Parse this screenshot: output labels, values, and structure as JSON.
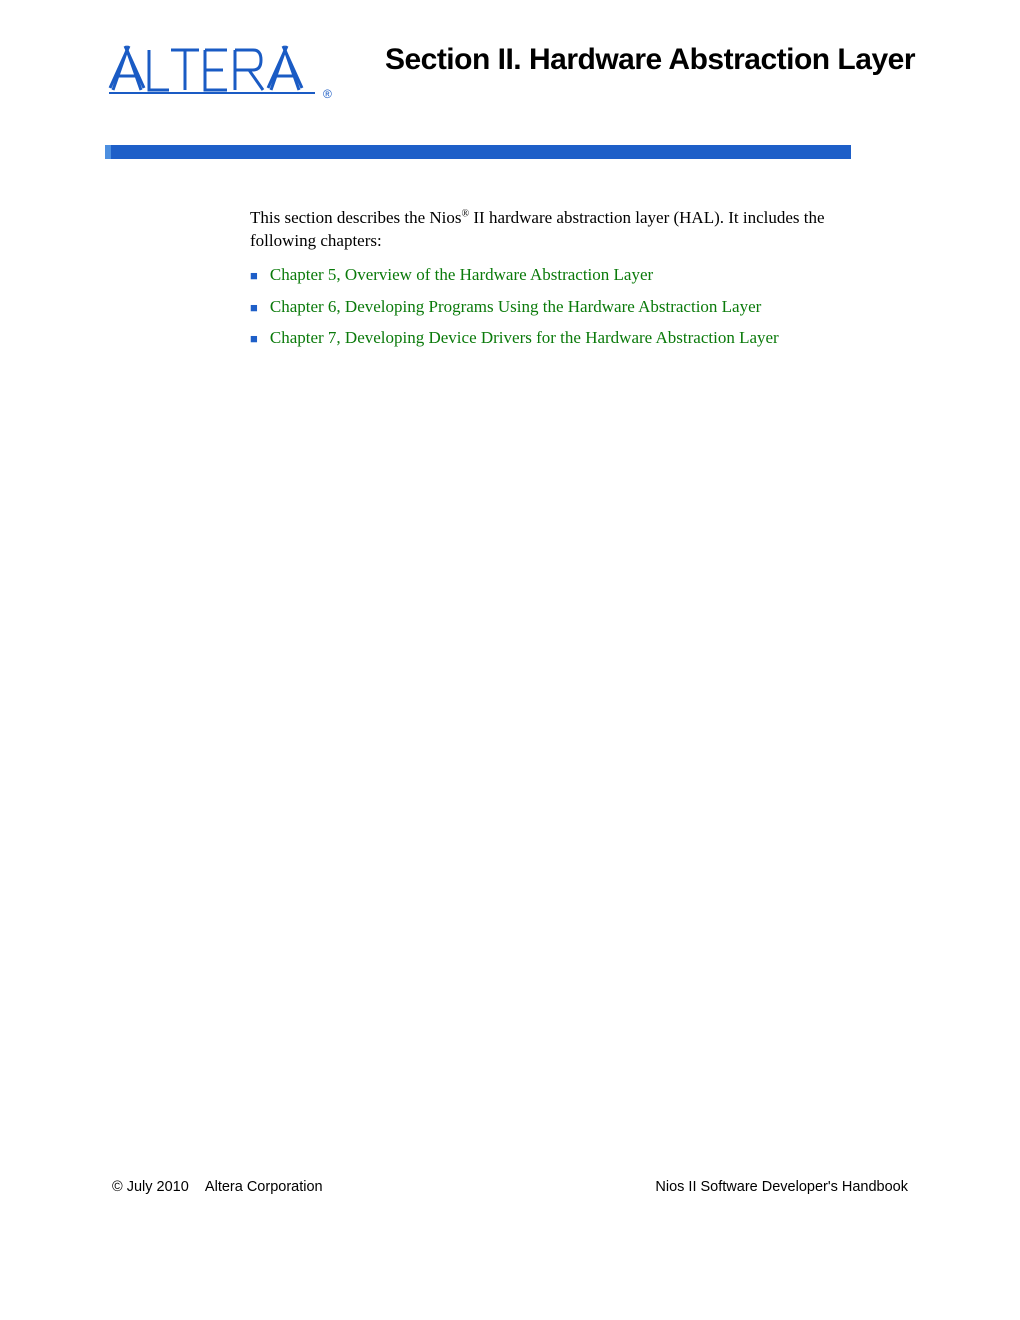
{
  "header": {
    "logo_text": "ALTERA",
    "section_title": "Section II. Hardware Abstraction Layer"
  },
  "content": {
    "intro_pre": "This section describes the Nios",
    "intro_reg": "®",
    "intro_post": " II hardware abstraction layer (HAL). It includes the following chapters:",
    "chapters": [
      "Chapter 5, Overview of the Hardware Abstraction Layer",
      "Chapter 6, Developing Programs Using the Hardware Abstraction Layer",
      "Chapter 7, Developing Device Drivers for the Hardware Abstraction Layer"
    ]
  },
  "footer": {
    "left_copyright": "© July 2010",
    "left_company": "Altera Corporation",
    "right": "Nios II Software Developer's Handbook"
  },
  "colors": {
    "blue_bar": "#1e5fc8",
    "blue_bar_accent": "#4d8fe0",
    "link_green": "#0a7a0a",
    "logo_blue": "#1a5bc4"
  }
}
